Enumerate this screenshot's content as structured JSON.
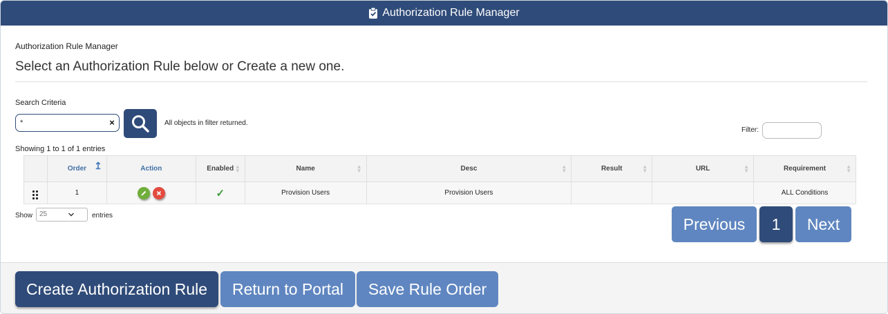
{
  "window": {
    "title": "Authorization Rule Manager",
    "icon": "clipboard-check-icon"
  },
  "page": {
    "breadcrumb": "Authorization Rule Manager",
    "headline": "Select an Authorization Rule below or Create a new one."
  },
  "search": {
    "label": "Search Criteria",
    "value": "*",
    "clear_glyph": "×",
    "message": "All objects in filter returned."
  },
  "filter": {
    "label": "Filter:",
    "value": ""
  },
  "table": {
    "info": "Showing 1 to 1 of 1 entries",
    "columns": [
      "Order",
      "Action",
      "Enabled",
      "Name",
      "Desc",
      "Result",
      "URL",
      "Requirement"
    ],
    "rows": [
      {
        "order": "1",
        "enabled": "✓",
        "name": "Provision Users",
        "desc": "Provision Users",
        "result": "",
        "url": "",
        "requirement": "ALL Conditions"
      }
    ]
  },
  "length": {
    "show_label": "Show",
    "selected": "25",
    "entries_label": "entries"
  },
  "pagination": {
    "previous": "Previous",
    "current_page": "1",
    "next": "Next"
  },
  "footer": {
    "create": "Create Authorization Rule",
    "return": "Return to Portal",
    "save": "Save Rule Order"
  },
  "colors": {
    "primary": "#2f4b79",
    "secondary": "#5f86c0",
    "edit": "#6fae3a",
    "delete": "#e34b3f",
    "check": "#3a9a3a"
  }
}
